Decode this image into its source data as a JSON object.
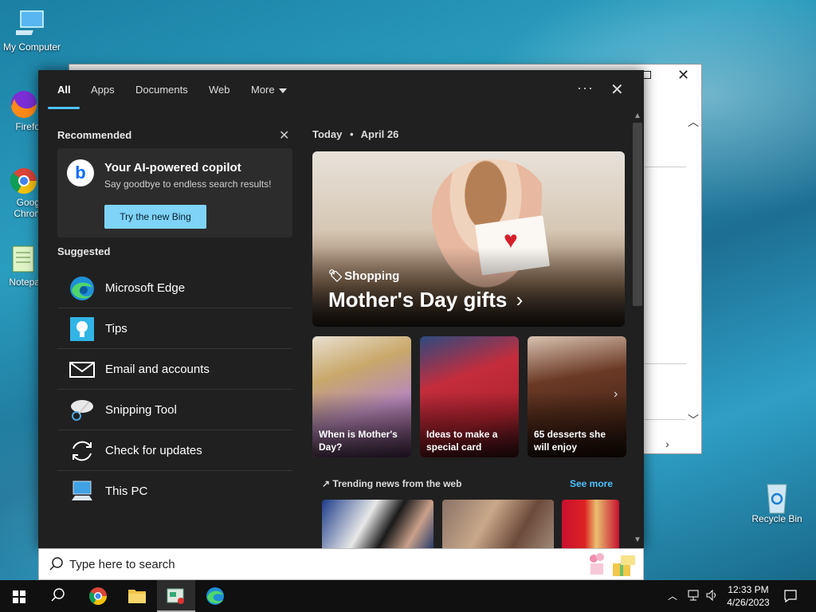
{
  "desktop": {
    "icons": [
      {
        "label": "My Computer"
      },
      {
        "label": "Firefo"
      },
      {
        "label": "Goog Chron"
      },
      {
        "label": "Notepa"
      },
      {
        "label": "Recycle Bin"
      }
    ]
  },
  "search_panel": {
    "tabs": [
      {
        "label": "All"
      },
      {
        "label": "Apps"
      },
      {
        "label": "Documents"
      },
      {
        "label": "Web"
      },
      {
        "label": "More"
      }
    ],
    "more_options_glyph": "···",
    "close_glyph": "✕",
    "recommended": {
      "title": "Recommended",
      "card_title": "Your AI-powered copilot",
      "card_subtitle": "Say goodbye to endless search results!",
      "button_label": "Try the new Bing"
    },
    "suggested": {
      "title": "Suggested",
      "items": [
        {
          "label": "Microsoft Edge",
          "icon": "edge-icon"
        },
        {
          "label": "Tips",
          "icon": "tips-icon"
        },
        {
          "label": "Email and accounts",
          "icon": "mail-icon"
        },
        {
          "label": "Snipping Tool",
          "icon": "snipping-tool-icon"
        },
        {
          "label": "Check for updates",
          "icon": "refresh-icon"
        },
        {
          "label": "This PC",
          "icon": "pc-icon"
        }
      ]
    },
    "feed": {
      "date_label": "Today",
      "date_value": "April 26",
      "hero": {
        "tag": "Shopping",
        "title": "Mother's Day gifts"
      },
      "tiles": [
        {
          "caption": "When is Mother's Day?"
        },
        {
          "caption": "Ideas to make a special card"
        },
        {
          "caption": "65 desserts she will enjoy"
        }
      ],
      "trending_title": "Trending news from the web",
      "see_more": "See more"
    }
  },
  "searchbox": {
    "placeholder": "Type here to search"
  },
  "taskbar": {
    "time": "12:33 PM",
    "date": "4/26/2023"
  },
  "colors": {
    "accent": "#4cc2ff",
    "panel_bg": "#202020",
    "button_bg": "#7ed3f7"
  }
}
